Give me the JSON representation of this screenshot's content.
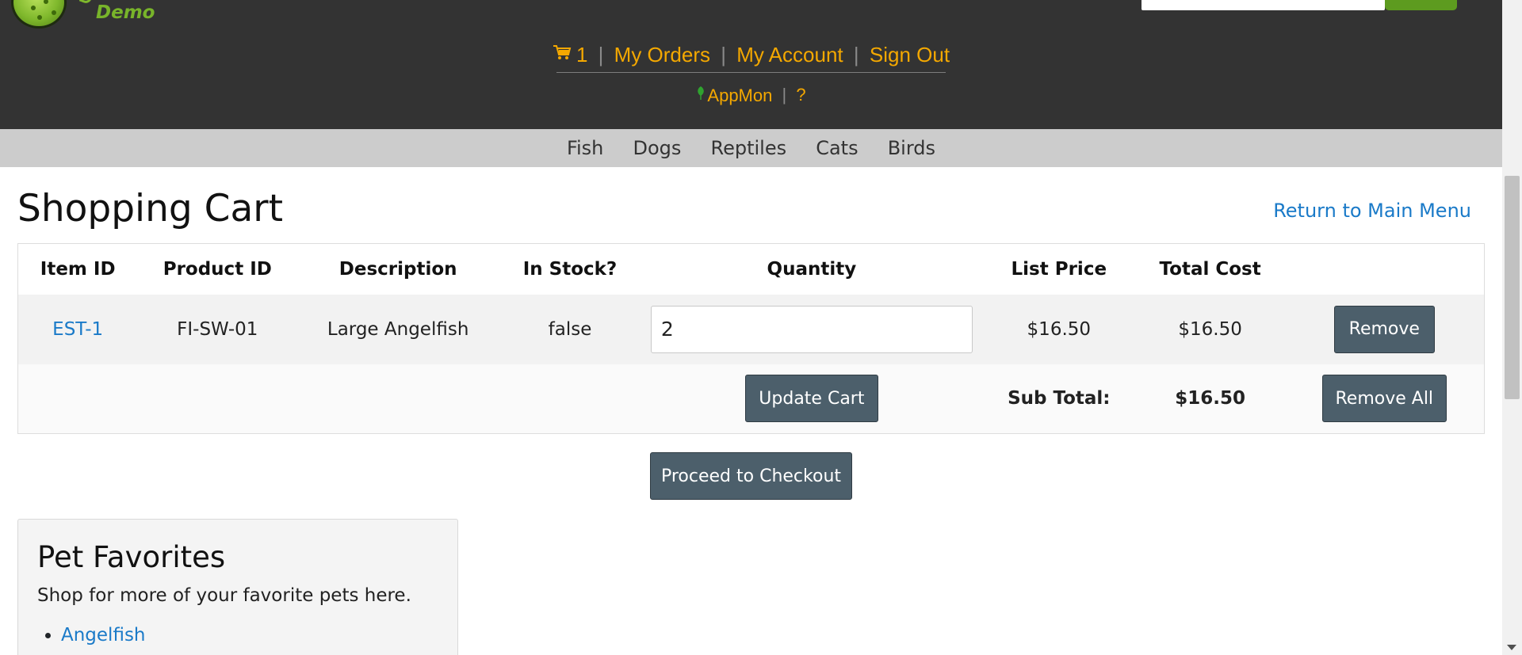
{
  "brand": {
    "sub": "Demo"
  },
  "header_nav": {
    "cart_count": "1",
    "separator": "|",
    "my_orders": "My Orders",
    "my_account": "My Account",
    "sign_out": "Sign Out",
    "appmon": "AppMon",
    "help": "?"
  },
  "categories": [
    "Fish",
    "Dogs",
    "Reptiles",
    "Cats",
    "Birds"
  ],
  "page": {
    "title": "Shopping Cart",
    "return_link": "Return to Main Menu"
  },
  "cart": {
    "headers": [
      "Item ID",
      "Product ID",
      "Description",
      "In Stock?",
      "Quantity",
      "List Price",
      "Total Cost"
    ],
    "items": [
      {
        "item_id": "EST-1",
        "product_id": "FI-SW-01",
        "description": "Large Angelfish",
        "in_stock": "false",
        "quantity": "2",
        "list_price": "$16.50",
        "total_cost": "$16.50",
        "remove_label": "Remove"
      }
    ],
    "update_label": "Update Cart",
    "subtotal_label": "Sub Total:",
    "subtotal_value": "$16.50",
    "remove_all_label": "Remove All"
  },
  "checkout_label": "Proceed to Checkout",
  "favorites": {
    "title": "Pet Favorites",
    "text": "Shop for more of your favorite pets here.",
    "items": [
      "Angelfish"
    ]
  },
  "colors": {
    "header_bg": "#333333",
    "nav_link": "#f4a800",
    "category_bar": "#cccccc",
    "link_blue": "#1a7ac8",
    "button_bg": "#4c5f6b",
    "brand_green": "#78b42a"
  },
  "icons": [
    "cart-icon",
    "leaf-icon",
    "scroll-down-arrow-icon"
  ]
}
